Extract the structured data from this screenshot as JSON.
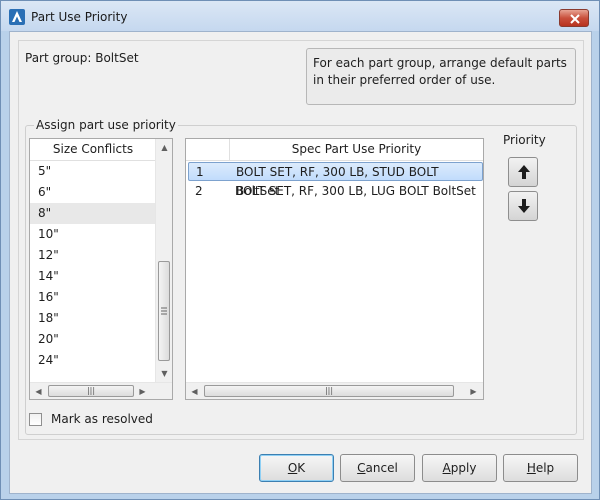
{
  "window": {
    "title": "Part Use Priority"
  },
  "part_group_label": "Part group: BoltSet",
  "info_text": "For each part group, arrange default parts in their preferred order of use.",
  "assign_group_label": "Assign part use priority",
  "size_conflicts": {
    "header": "Size Conflicts",
    "items": [
      "5\"",
      "6\"",
      "8\"",
      "10\"",
      "12\"",
      "14\"",
      "16\"",
      "18\"",
      "20\"",
      "24\""
    ],
    "selected": "8\""
  },
  "spec_priority": {
    "header": "Spec Part Use Priority",
    "rows": [
      {
        "num": "1",
        "text": "BOLT SET, RF, 300 LB, STUD BOLT BoltSet",
        "selected": true
      },
      {
        "num": "2",
        "text": "BOLT SET, RF, 300 LB, LUG BOLT BoltSet",
        "selected": false
      }
    ]
  },
  "priority_label": "Priority",
  "mark_resolved_label": "Mark as resolved",
  "mark_resolved_checked": false,
  "buttons": {
    "ok_mnemonic": "O",
    "ok_rest": "K",
    "cancel_mnemonic": "C",
    "cancel_rest": "ancel",
    "apply_mnemonic": "A",
    "apply_rest": "pply",
    "help_mnemonic": "H",
    "help_rest": "elp"
  },
  "icons": {
    "app": "autocad-a-icon",
    "close": "close-icon",
    "up": "arrow-up-icon",
    "down": "arrow-down-icon"
  }
}
